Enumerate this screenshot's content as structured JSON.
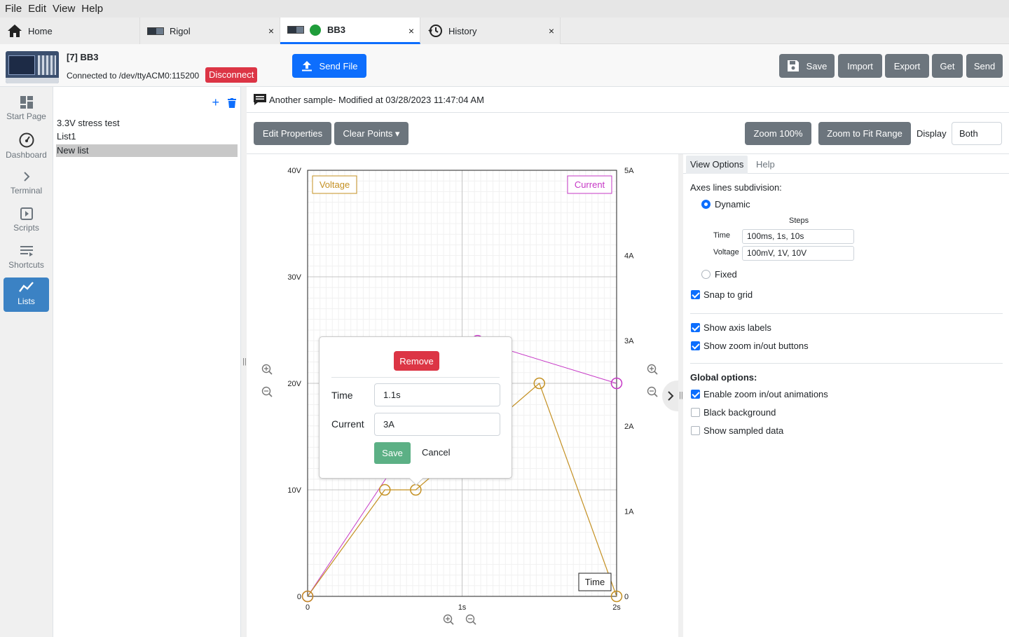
{
  "menu": [
    "File",
    "Edit",
    "View",
    "Help"
  ],
  "tabs": [
    {
      "label": "Home",
      "icon": "home-icon"
    },
    {
      "label": "Rigol",
      "icon": "instrument-thumbnail-icon",
      "close": "×"
    },
    {
      "label": "BB3",
      "icon": "instrument-thumbnail-icon",
      "status_color": "#1f9d3a",
      "close": "×"
    },
    {
      "label": "History",
      "icon": "history-icon",
      "close": "×"
    }
  ],
  "header": {
    "device_name": "[7] BB3",
    "connection": "Connected to /dev/ttyACM0:115200",
    "disconnect": "Disconnect",
    "send_file": "Send File",
    "save": "Save",
    "import": "Import",
    "export": "Export",
    "get": "Get",
    "send": "Send"
  },
  "sidebar": [
    {
      "label": "Start Page",
      "icon": "dashboard-grid-icon"
    },
    {
      "label": "Dashboard",
      "icon": "gauge-icon"
    },
    {
      "label": "Terminal",
      "icon": "chevron-right-icon"
    },
    {
      "label": "Scripts",
      "icon": "play-box-icon"
    },
    {
      "label": "Shortcuts",
      "icon": "list-lines-icon"
    },
    {
      "label": "Lists",
      "icon": "chart-line-icon",
      "active": true
    }
  ],
  "lists": {
    "add": "+",
    "items": [
      "3.3V stress test",
      "List1",
      "New list"
    ],
    "selected_index": 2
  },
  "description": "Another sample- Modified at 03/28/2023 11:47:04 AM",
  "toolbar": {
    "edit_properties": "Edit Properties",
    "clear_points": "Clear Points ▾",
    "zoom_100": "Zoom 100%",
    "zoom_fit": "Zoom to Fit Range",
    "display_label": "Display",
    "display_value": "Both"
  },
  "chart_data": {
    "type": "line",
    "voltage_label": "Voltage",
    "current_label": "Current",
    "time_label": "Time",
    "voltage_color": "#c49022",
    "current_color": "#c638c6",
    "x_ticks": [
      "0",
      "1s",
      "2s"
    ],
    "y_left_ticks": [
      "0",
      "10V",
      "20V",
      "30V",
      "40V"
    ],
    "y_right_ticks": [
      "0",
      "1A",
      "2A",
      "3A",
      "4A",
      "5A"
    ],
    "xlim": [
      0,
      2
    ],
    "ylim_voltage": [
      0,
      40
    ],
    "ylim_current": [
      0,
      5
    ],
    "series": [
      {
        "name": "Voltage",
        "unit": "V",
        "x": [
          0,
          0.5,
          0.7,
          1.5,
          2.0
        ],
        "y": [
          0,
          10,
          10,
          20,
          0
        ]
      },
      {
        "name": "Current",
        "unit": "A",
        "x": [
          0,
          1.1,
          2.0
        ],
        "y": [
          0,
          3,
          2.5
        ]
      }
    ]
  },
  "popup": {
    "remove": "Remove",
    "time_label": "Time",
    "time_value": "1.1s",
    "current_label": "Current",
    "current_value": "3A",
    "save": "Save",
    "cancel": "Cancel"
  },
  "options": {
    "tabs": [
      "View Options",
      "Help"
    ],
    "axes_subdivision": "Axes lines subdivision:",
    "dynamic": "Dynamic",
    "steps": "Steps",
    "time_label": "Time",
    "time_steps": "100ms, 1s, 10s",
    "voltage_label": "Voltage",
    "voltage_steps": "100mV, 1V, 10V",
    "fixed": "Fixed",
    "snap_to_grid": "Snap to grid",
    "show_axis_labels": "Show axis labels",
    "show_zoom_buttons": "Show zoom in/out buttons",
    "global_options": "Global options:",
    "enable_zoom_anim": "Enable zoom in/out animations",
    "black_background": "Black background",
    "show_sampled_data": "Show sampled data",
    "checked": {
      "snap_to_grid": true,
      "show_axis_labels": true,
      "show_zoom_buttons": true,
      "enable_zoom_anim": true,
      "black_background": false,
      "show_sampled_data": false
    },
    "dynamic_selected": true
  }
}
